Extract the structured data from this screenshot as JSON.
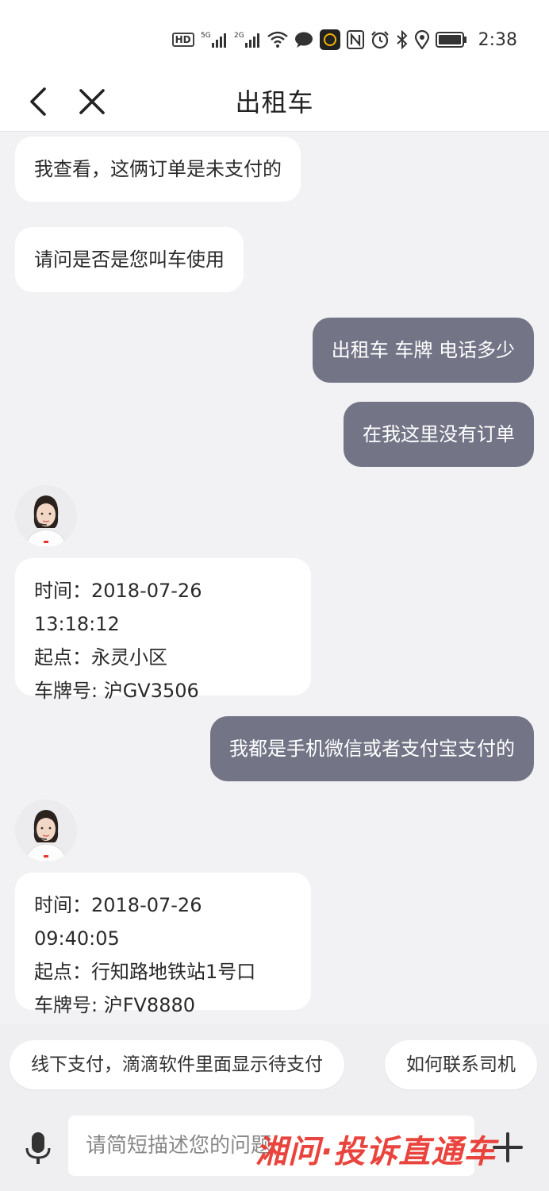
{
  "status_bar": {
    "time": "2:38",
    "hd_label": "HD",
    "net1": "5G",
    "net2": "2G"
  },
  "header": {
    "title": "出租车"
  },
  "messages": [
    {
      "side": "left",
      "text": "我查看，这俩订单是未支付的"
    },
    {
      "side": "left",
      "text": "请问是否是您叫车使用"
    },
    {
      "side": "right",
      "text": "出租车 车牌 电话多少"
    },
    {
      "side": "right",
      "text": "在我这里没有订单"
    },
    {
      "side": "left",
      "type": "card",
      "lines": [
        "时间：2018-07-26 13:18:12",
        "起点：永灵小区",
        "车牌号: 沪GV3506"
      ]
    },
    {
      "side": "right",
      "text": "我都是手机微信或者支付宝支付的"
    },
    {
      "side": "left",
      "type": "card",
      "lines": [
        "时间：2018-07-26 09:40:05",
        "起点：行知路地铁站1号口",
        "车牌号: 沪FV8880"
      ]
    }
  ],
  "quick_replies": [
    "线下支付，滴滴软件里面显示待支付",
    "如何联系司机"
  ],
  "input": {
    "placeholder": "请简短描述您的问题"
  },
  "watermark": "湘问·投诉直通车",
  "colors": {
    "user_bubble": "#737587",
    "agent_bubble": "#ffffff",
    "background": "#f2f2f4",
    "watermark": "#e8352d"
  },
  "icons": [
    "back-icon",
    "close-icon",
    "mic-icon",
    "plus-icon",
    "agent-avatar"
  ]
}
